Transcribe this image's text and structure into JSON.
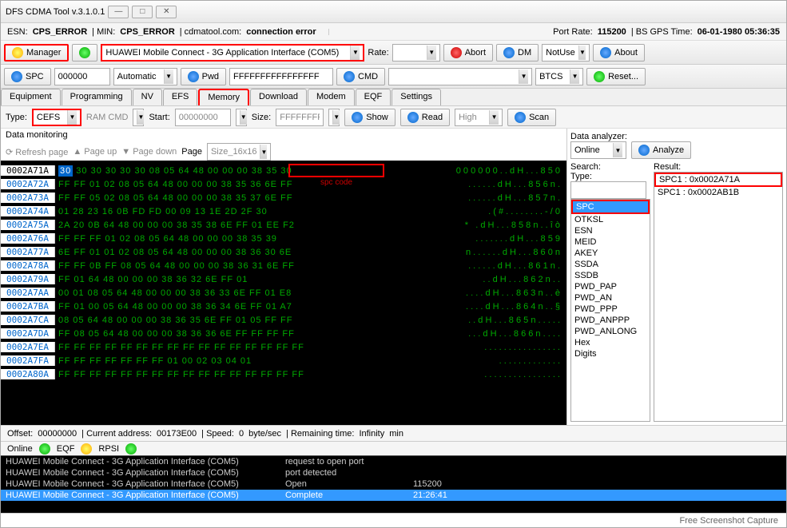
{
  "title": "DFS CDMA Tool v.3.1.0.1",
  "status": {
    "esn": "ESN:",
    "esn_v": "CPS_ERROR",
    "min": "| MIN:",
    "min_v": "CPS_ERROR",
    "site": "| cdmatool.com:",
    "conn": "connection error",
    "port": "Port Rate:",
    "port_v": "115200",
    "gps": "| BS GPS Time:",
    "gps_v": "06-01-1980 05:36:35"
  },
  "toolbar": {
    "manager": "Manager",
    "device": "HUAWEI Mobile Connect - 3G Application Interface (COM5)",
    "rate": "Rate:",
    "abort": "Abort",
    "dm": "DM",
    "dm_v": "NotUse",
    "about": "About"
  },
  "toolbar2": {
    "spc": "SPC",
    "spc_v": "000000",
    "auto": "Automatic",
    "pwd": "Pwd",
    "pwd_v": "FFFFFFFFFFFFFFFF",
    "cmd": "CMD",
    "btcs": "BTCS",
    "reset": "Reset..."
  },
  "tabs": [
    "Equipment",
    "Programming",
    "NV",
    "EFS",
    "Memory",
    "Download",
    "Modem",
    "EQF",
    "Settings"
  ],
  "type": {
    "lbl": "Type:",
    "v": "CEFS",
    "ram": "RAM CMD",
    "start": "Start:",
    "start_v": "00000000",
    "size": "Size:",
    "size_v": "FFFFFFFF",
    "show": "Show",
    "read": "Read",
    "high": "High",
    "scan": "Scan"
  },
  "monitoring": "Data monitoring",
  "refresh": "Refresh page",
  "pageup": "Page up",
  "pagedown": "Page down",
  "page": "Page",
  "size16": "Size_16x16",
  "spc_code": "spc code",
  "hex": [
    {
      "a": "0002A71A",
      "h": "30 30 30 30 30 30 08 05 64 48 00 00 00 38 35 30",
      "t": "0 0 0 0 0 0 . . d H . . . 8 5 0"
    },
    {
      "a": "0002A72A",
      "h": "FF FF 01 02 08 05 64 48 00 00 00 38 35 36 6E FF",
      "t": ". . . . . . d H . . . 8 5 6 n ."
    },
    {
      "a": "0002A73A",
      "h": "FF FF 05 02 08 05 64 48 00 00 00 38 35 37 6E FF",
      "t": ". . . . . . d H . . . 8 5 7 n ."
    },
    {
      "a": "0002A74A",
      "h": "01 28 23 16 0B FD FD 00 09 13 1E 2D 2F 30",
      "t": ". ( # . . . . . . . . - / 0"
    },
    {
      "a": "0002A75A",
      "h": "2A 20 0B 64 48 00 00 00 38 35 38 6E FF 01 EE F2",
      "t": "*   . d H . . . 8 5 8 n . . î ò"
    },
    {
      "a": "0002A76A",
      "h": "FF FF FF 01 02 08 05 64 48 00 00 00 38 35 39",
      "t": ". . . . . . . d H . . . 8 5 9"
    },
    {
      "a": "0002A77A",
      "h": "6E FF 01 01 02 08 05 64 48 00 00 00 38 36 30 6E",
      "t": "n . . . . . . d H . . . 8 6 0 n"
    },
    {
      "a": "0002A78A",
      "h": "FF FF 0B FF 08 05 64 48 00 00 00 38 36 31 6E FF",
      "t": ". . . . . . d H . . . 8 6 1 n ."
    },
    {
      "a": "0002A79A",
      "h": "FF 01 64 48 00 00 00 38 36 32 6E FF 01",
      "t": ". . d H . . . 8 6 2 n . ."
    },
    {
      "a": "0002A7AA",
      "h": "00 01 08 05 64 48 00 00 00 38 36 33 6E FF 01 E8",
      "t": ". . . . d H . . . 8 6 3 n . . è"
    },
    {
      "a": "0002A7BA",
      "h": "FF 01 00 05 64 48 00 00 00 38 36 34 6E FF 01 A7",
      "t": ". . . . d H . . . 8 6 4 n . . §"
    },
    {
      "a": "0002A7CA",
      "h": "08 05 64 48 00 00 00 38 36 35 6E FF 01 05 FF FF",
      "t": ". . d H . . . 8 6 5 n . . . . ."
    },
    {
      "a": "0002A7DA",
      "h": "FF 08 05 64 48 00 00 00 38 36 36 6E FF FF FF FF",
      "t": ". . . d H . . . 8 6 6 n . . . ."
    },
    {
      "a": "0002A7EA",
      "h": "FF FF FF FF FF FF FF FF FF FF FF FF FF FF FF FF",
      "t": ". . . . . . . . . . . . . . . ."
    },
    {
      "a": "0002A7FA",
      "h": "FF FF FF FF FF FF FF 01 00 02 03 04 01",
      "t": ". . . . . . . . . . . . ."
    },
    {
      "a": "0002A80A",
      "h": "FF FF FF FF FF FF FF FF FF FF FF FF FF FF FF FF",
      "t": ". . . . . . . . . . . . . . . ."
    }
  ],
  "analyzer": {
    "lbl": "Data analyzer:",
    "online": "Online",
    "analyze": "Analyze",
    "search": "Search:",
    "type": "Type:",
    "result": "Result:"
  },
  "searchlist": [
    "SPC",
    "OTKSL",
    "ESN",
    "MEID",
    "AKEY",
    "SSDA",
    "SSDB",
    "PWD_PAP",
    "PWD_AN",
    "PWD_PPP",
    "PWD_ANPPP",
    "PWD_ANLONG",
    "Hex",
    "Digits"
  ],
  "results": [
    "SPC1 : 0x0002A71A",
    "SPC1 : 0x0002AB1B"
  ],
  "bottom": {
    "offset": "Offset:",
    "offset_v": "00000000",
    "curr": "| Current address:",
    "curr_v": "00173E00",
    "speed": "| Speed:",
    "speed_v": "0",
    "bs": "byte/sec",
    "rem": "| Remaining time:",
    "rem_v": "Infinity",
    "min": "min"
  },
  "onlinebar": {
    "online": "Online",
    "eqf": "EQF",
    "rpsi": "RPSI"
  },
  "log": [
    {
      "d": "HUAWEI Mobile Connect - 3G Application Interface (COM5)",
      "s": "request to open port",
      "t": ""
    },
    {
      "d": "HUAWEI Mobile Connect - 3G Application Interface (COM5)",
      "s": "port detected",
      "t": ""
    },
    {
      "d": "HUAWEI Mobile Connect - 3G Application Interface (COM5)",
      "s": "Open",
      "t": "115200",
      "cls": "g"
    },
    {
      "d": "HUAWEI Mobile Connect - 3G Application Interface (COM5)",
      "s": "Complete",
      "t": "21:26:41",
      "cls": "sel"
    }
  ],
  "footer": "Free Screenshot Capture"
}
